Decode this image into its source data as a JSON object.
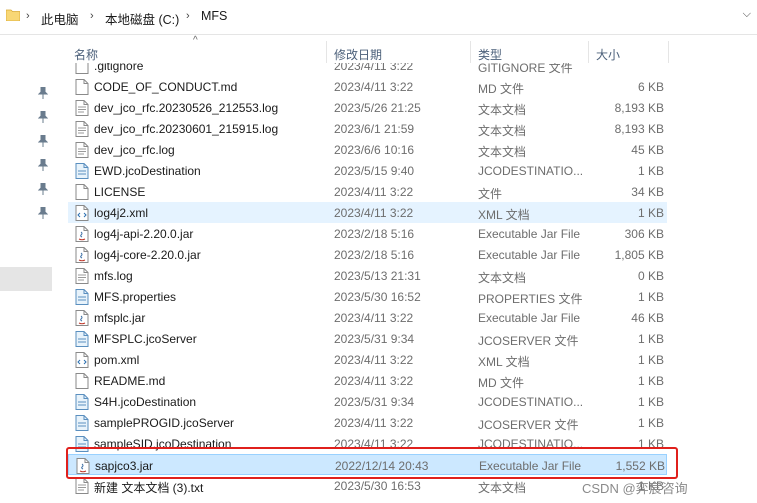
{
  "address_bar": {
    "crumbs": [
      "此电脑",
      "本地磁盘 (C:)",
      "MFS"
    ]
  },
  "columns": {
    "name": "名称",
    "date": "修改日期",
    "type": "类型",
    "size": "大小"
  },
  "files": [
    {
      "name": ".gitignore",
      "date": "2023/4/11 3:22",
      "type": "GITIGNORE 文件",
      "size": "",
      "icon": "generic-file-icon"
    },
    {
      "name": "CODE_OF_CONDUCT.md",
      "date": "2023/4/11 3:22",
      "type": "MD 文件",
      "size": "6 KB",
      "icon": "generic-file-icon"
    },
    {
      "name": "dev_jco_rfc.20230526_212553.log",
      "date": "2023/5/26 21:25",
      "type": "文本文档",
      "size": "8,193 KB",
      "icon": "text-file-icon"
    },
    {
      "name": "dev_jco_rfc.20230601_215915.log",
      "date": "2023/6/1 21:59",
      "type": "文本文档",
      "size": "8,193 KB",
      "icon": "text-file-icon"
    },
    {
      "name": "dev_jco_rfc.log",
      "date": "2023/6/6 10:16",
      "type": "文本文档",
      "size": "45 KB",
      "icon": "text-file-icon"
    },
    {
      "name": "EWD.jcoDestination",
      "date": "2023/5/15 9:40",
      "type": "JCODESTINATIO...",
      "size": "1 KB",
      "icon": "config-file-icon"
    },
    {
      "name": "LICENSE",
      "date": "2023/4/11 3:22",
      "type": "文件",
      "size": "34 KB",
      "icon": "generic-file-icon"
    },
    {
      "name": "log4j2.xml",
      "date": "2023/4/11 3:22",
      "type": "XML 文档",
      "size": "1 KB",
      "icon": "xml-file-icon"
    },
    {
      "name": "log4j-api-2.20.0.jar",
      "date": "2023/2/18 5:16",
      "type": "Executable Jar File",
      "size": "306 KB",
      "icon": "jar-file-icon"
    },
    {
      "name": "log4j-core-2.20.0.jar",
      "date": "2023/2/18 5:16",
      "type": "Executable Jar File",
      "size": "1,805 KB",
      "icon": "jar-file-icon"
    },
    {
      "name": "mfs.log",
      "date": "2023/5/13 21:31",
      "type": "文本文档",
      "size": "0 KB",
      "icon": "text-file-icon"
    },
    {
      "name": "MFS.properties",
      "date": "2023/5/30 16:52",
      "type": "PROPERTIES 文件",
      "size": "1 KB",
      "icon": "config-file-icon"
    },
    {
      "name": "mfsplc.jar",
      "date": "2023/4/11 3:22",
      "type": "Executable Jar File",
      "size": "46 KB",
      "icon": "jar-file-icon"
    },
    {
      "name": "MFSPLC.jcoServer",
      "date": "2023/5/31 9:34",
      "type": "JCOSERVER 文件",
      "size": "1 KB",
      "icon": "config-file-icon"
    },
    {
      "name": "pom.xml",
      "date": "2023/4/11 3:22",
      "type": "XML 文档",
      "size": "1 KB",
      "icon": "xml-file-icon"
    },
    {
      "name": "README.md",
      "date": "2023/4/11 3:22",
      "type": "MD 文件",
      "size": "1 KB",
      "icon": "generic-file-icon"
    },
    {
      "name": "S4H.jcoDestination",
      "date": "2023/5/31 9:34",
      "type": "JCODESTINATIO...",
      "size": "1 KB",
      "icon": "config-file-icon"
    },
    {
      "name": "samplePROGID.jcoServer",
      "date": "2023/4/11 3:22",
      "type": "JCOSERVER 文件",
      "size": "1 KB",
      "icon": "config-file-icon"
    },
    {
      "name": "sampleSID.jcoDestination",
      "date": "2023/4/11 3:22",
      "type": "JCODESTINATIO...",
      "size": "1 KB",
      "icon": "config-file-icon"
    },
    {
      "name": "sapjco3.jar",
      "date": "2022/12/14 20:43",
      "type": "Executable Jar File",
      "size": "1,552 KB",
      "icon": "jar-file-icon"
    },
    {
      "name": "新建 文本文档 (3).txt",
      "date": "2023/5/30 16:53",
      "type": "文本文档",
      "size": "1 KB",
      "icon": "text-file-icon"
    }
  ],
  "selection": {
    "light_row": "log4j2.xml",
    "strong_row": "sapjco3.jar",
    "highlight_color": "#e0201c"
  },
  "watermark": "CSDN @弈宸咨询"
}
